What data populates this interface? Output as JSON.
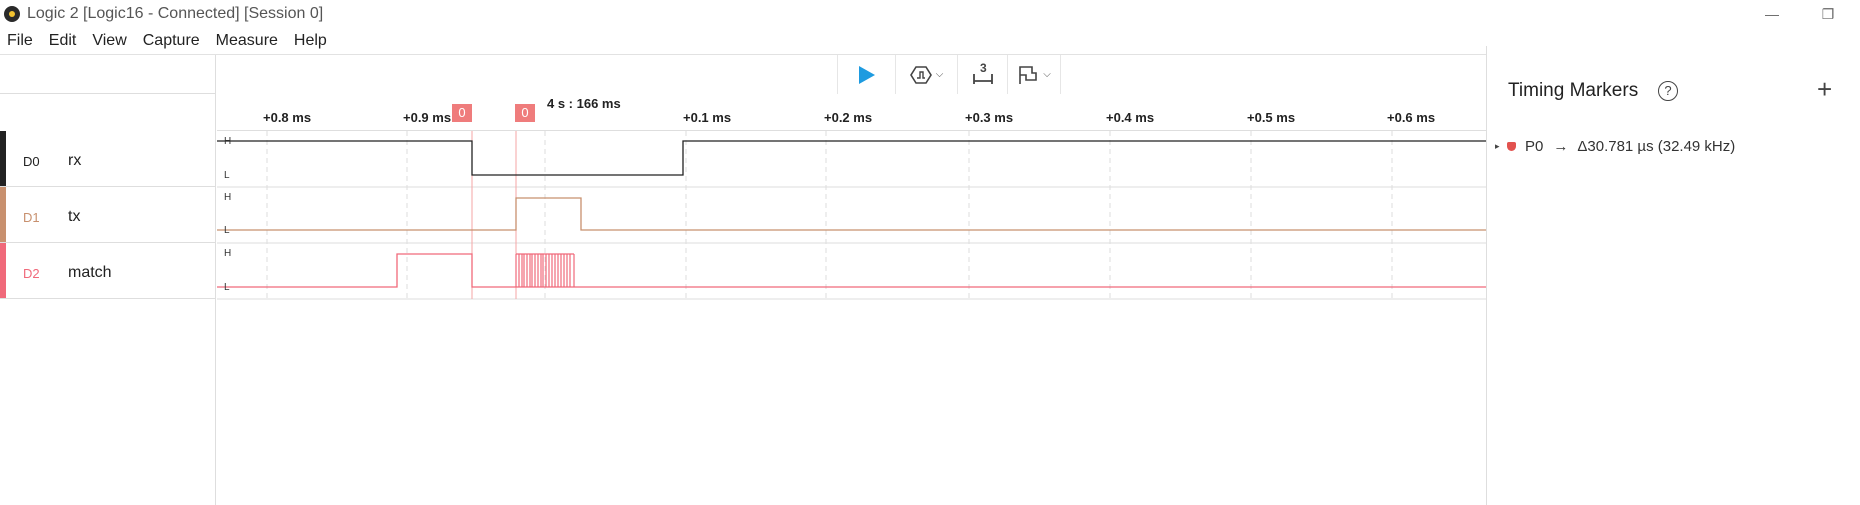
{
  "window": {
    "title": "Logic 2 [Logic16 - Connected] [Session 0]",
    "minimize_glyph": "—",
    "maximize_glyph": "❐"
  },
  "menu": [
    "File",
    "Edit",
    "View",
    "Capture",
    "Measure",
    "Help"
  ],
  "toolbar": {
    "run_icon": "play-icon",
    "trigger_icon": "trigger-icon",
    "measure_icon": "measure-icon",
    "marker_icon": "flag-icon",
    "measure_badge": "3"
  },
  "timeline": {
    "ticks": [
      "+0.8 ms",
      "+0.9 ms",
      "+0.1 ms",
      "+0.2 ms",
      "+0.3 ms",
      "+0.4 ms",
      "+0.5 ms",
      "+0.6 ms"
    ],
    "cursor_time": "4 s : 166 ms",
    "marker_flags": [
      "0",
      "0"
    ]
  },
  "channels": [
    {
      "id": "D0",
      "name": "rx",
      "color": "#222222",
      "high": "H",
      "low": "L"
    },
    {
      "id": "D1",
      "name": "tx",
      "color": "#c8906e",
      "high": "H",
      "low": "L"
    },
    {
      "id": "D2",
      "name": "match",
      "color": "#f0697a",
      "high": "H",
      "low": "L"
    }
  ],
  "timing_markers": {
    "title": "Timing Markers",
    "help_glyph": "?",
    "add_glyph": "+",
    "markers": [
      {
        "name": "P0",
        "arrow": "→",
        "value": "Δ30.781 µs (32.49 kHz)"
      }
    ]
  }
}
